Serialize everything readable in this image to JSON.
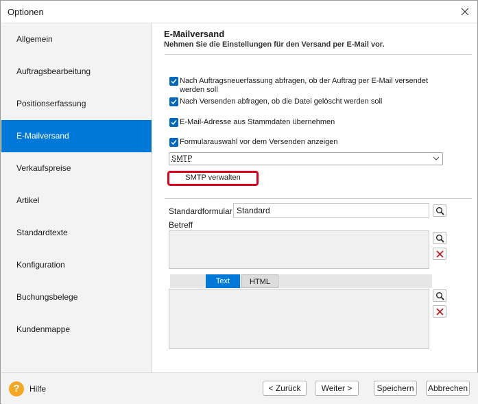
{
  "window": {
    "title": "Optionen"
  },
  "sidebar": {
    "items": [
      {
        "label": "Allgemein"
      },
      {
        "label": "Auftragsbearbeitung"
      },
      {
        "label": "Positionserfassung"
      },
      {
        "label": "E-Mailversand"
      },
      {
        "label": "Verkaufspreise"
      },
      {
        "label": "Artikel"
      },
      {
        "label": "Standardtexte"
      },
      {
        "label": "Konfiguration"
      },
      {
        "label": "Buchungsbelege"
      },
      {
        "label": "Kundenmappe"
      }
    ],
    "active": "E-Mailversand"
  },
  "section": {
    "title": "E-Mailversand",
    "subtitle": "Nehmen Sie die Einstellungen für den Versand per E-Mail vor."
  },
  "options": {
    "cb1_line1": "Nach Auftragsneuerfassung abfragen, ob der Auftrag per E-Mail versendet",
    "cb1_line2": "werden soll",
    "cb2": "Nach Versenden abfragen, ob die Datei gelöscht werden soll",
    "cb3": "E-Mail-Adresse aus Stammdaten übernehmen",
    "cb4": "Formularauswahl vor dem Versenden anzeigen"
  },
  "smtp": {
    "selected": "SMTP",
    "manage_label": "SMTP verwalten"
  },
  "form": {
    "standardformular_label": "Standardformular",
    "standardformular_value": "Standard",
    "betreff_label": "Betreff"
  },
  "tabs": [
    {
      "label": "Text",
      "active": true
    },
    {
      "label": "HTML",
      "active": false
    }
  ],
  "footer": {
    "help_glyph": "?",
    "help_label": "Hilfe",
    "back_label": "< Zurück",
    "next_label": "Weiter >",
    "save_label": "Speichern",
    "cancel_label": "Abbrechen"
  },
  "colors": {
    "accent": "#0078d7",
    "highlight_border": "#d9001b",
    "help_icon": "#f5a623",
    "delete_icon": "#c0202a"
  },
  "icons": [
    "close-icon",
    "checkmark-icon",
    "chevron-down-icon",
    "search-icon",
    "delete-x-icon",
    "help-icon"
  ]
}
